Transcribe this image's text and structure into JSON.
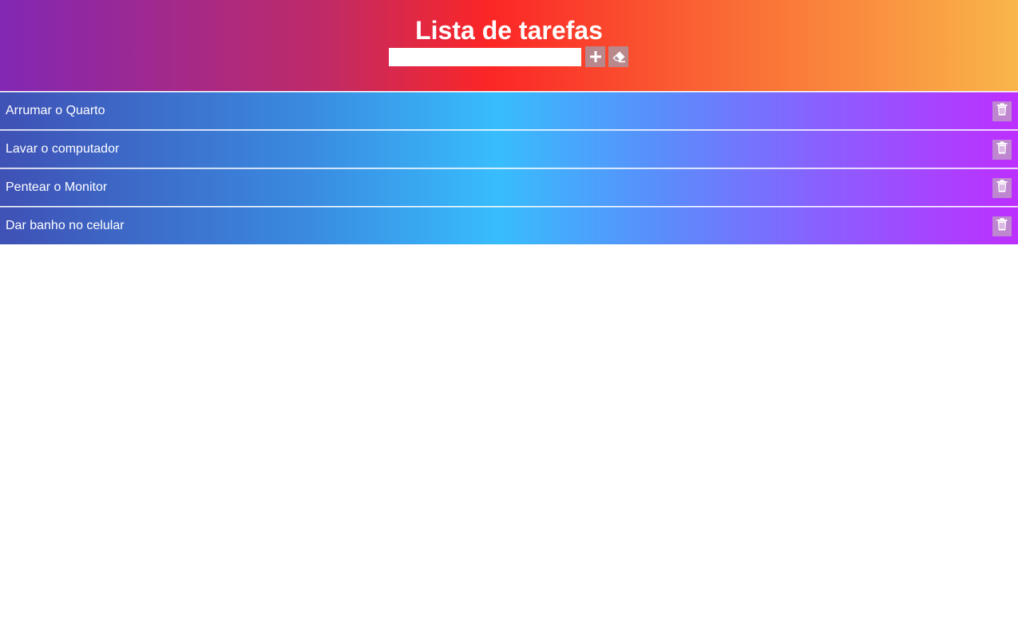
{
  "header": {
    "title": "Lista de tarefas",
    "input": {
      "value": "",
      "placeholder": ""
    },
    "buttons": [
      {
        "name": "add-task-button",
        "icon": "plus-icon"
      },
      {
        "name": "clear-tasks-button",
        "icon": "eraser-icon"
      }
    ],
    "gradient_colors": [
      "#8228b4",
      "#c02a66",
      "#fb2626",
      "#fa6b35",
      "#f9b64a"
    ]
  },
  "tasks": [
    {
      "label": "Arrumar o Quarto",
      "icon": "trash-icon"
    },
    {
      "label": "Lavar o computador",
      "icon": "trash-icon"
    },
    {
      "label": "Pentear o Monitor",
      "icon": "trash-icon"
    },
    {
      "label": "Dar banho no celular",
      "icon": "trash-icon"
    }
  ],
  "task_gradient_colors": [
    "#3f51b5",
    "#3a8ae0",
    "#38bdfd",
    "#5a8dfb",
    "#8d5cff",
    "#bd2fff"
  ]
}
